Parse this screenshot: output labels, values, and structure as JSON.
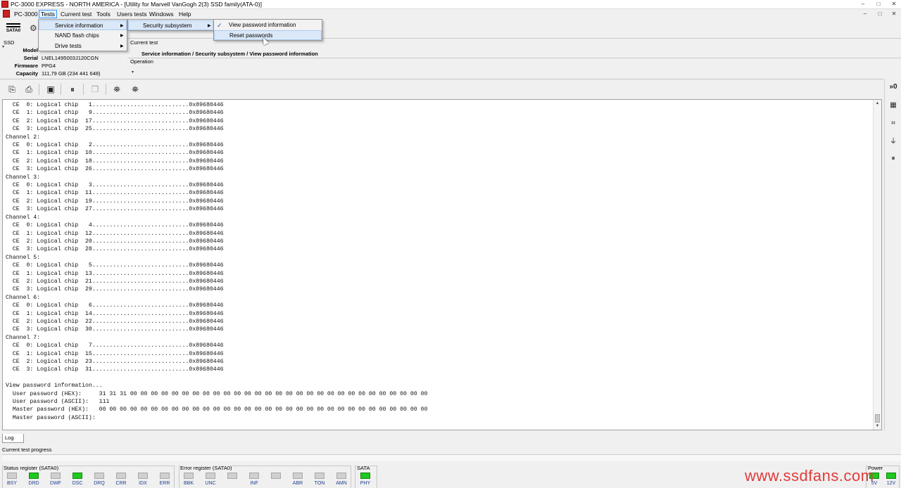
{
  "window": {
    "title": "PC-3000 EXPRESS - NORTH AMERICA - [Utility for Marvell VanGogh 2(3) SSD family(ATA-0)]",
    "controls": [
      "–",
      "□",
      "✕"
    ]
  },
  "menubar": {
    "items": [
      "PC-3000",
      "Tests",
      "Current test",
      "Tools",
      "Users tests",
      "Windows",
      "Help"
    ],
    "mdi_controls": [
      "–",
      "□",
      "✕"
    ]
  },
  "toolbar": {
    "sata_label": "SATA0",
    "icons": [
      "sata-port-icon",
      "gear-icon"
    ]
  },
  "device": {
    "section_label": "SSD",
    "model_label": "Model",
    "serial_label": "Serial",
    "serial": "LNEL1495003J120CGN",
    "firmware_label": "Firmware",
    "firmware": "PPG4",
    "capacity_label": "Capacity",
    "capacity": "111,79 GB (234 441 648)"
  },
  "current_test": {
    "label": "Current test",
    "path": "Service information / Security subsystem / View password information",
    "operation_label": "Operation"
  },
  "menus": {
    "tests": {
      "items": [
        "Service information",
        "NAND flash chips",
        "Drive tests"
      ]
    },
    "service_information": {
      "items": [
        "Security subsystem"
      ]
    },
    "security_subsystem": {
      "items": [
        "View password information",
        "Reset passwords"
      ],
      "checked": "View password information",
      "hovered": "Reset passwords"
    }
  },
  "log": {
    "lines": [
      "  CE  0: Logical chip   1............................0x89680446",
      "  CE  1: Logical chip   9............................0x89680446",
      "  CE  2: Logical chip  17............................0x89680446",
      "  CE  3: Logical chip  25............................0x89680446",
      "Channel 2:",
      "  CE  0: Logical chip   2............................0x89680446",
      "  CE  1: Logical chip  10............................0x89680446",
      "  CE  2: Logical chip  18............................0x89680446",
      "  CE  3: Logical chip  26............................0x89680446",
      "Channel 3:",
      "  CE  0: Logical chip   3............................0x89680446",
      "  CE  1: Logical chip  11............................0x89680446",
      "  CE  2: Logical chip  19............................0x89680446",
      "  CE  3: Logical chip  27............................0x89680446",
      "Channel 4:",
      "  CE  0: Logical chip   4............................0x89680446",
      "  CE  1: Logical chip  12............................0x89680446",
      "  CE  2: Logical chip  20............................0x89680446",
      "  CE  3: Logical chip  28............................0x89680446",
      "Channel 5:",
      "  CE  0: Logical chip   5............................0x89680446",
      "  CE  1: Logical chip  13............................0x89680446",
      "  CE  2: Logical chip  21............................0x89680446",
      "  CE  3: Logical chip  29............................0x89680446",
      "Channel 6:",
      "  CE  0: Logical chip   6............................0x89680446",
      "  CE  1: Logical chip  14............................0x89680446",
      "  CE  2: Logical chip  22............................0x89680446",
      "  CE  3: Logical chip  30............................0x89680446",
      "Channel 7:",
      "  CE  0: Logical chip   7............................0x89680446",
      "  CE  1: Logical chip  15............................0x89680446",
      "  CE  2: Logical chip  23............................0x89680446",
      "  CE  3: Logical chip  31............................0x89680446",
      "",
      "View password information...",
      "  User password (HEX):     31 31 31 00 00 00 00 00 00 00 00 00 00 00 00 00 00 00 00 00 00 00 00 00 00 00 00 00 00 00 00 00",
      "  User password (ASCII):   111",
      "  Master password (HEX):   00 00 00 00 00 00 00 00 00 00 00 00 00 00 00 00 00 00 00 00 00 00 00 00 00 00 00 00 00 00 00 00",
      "  Master password (ASCII):"
    ]
  },
  "bottom": {
    "log_tab": "Log",
    "progress_label": "Current test progress",
    "status_register_title": "Status register (SATA0)",
    "status_leds": [
      {
        "label": "BSY",
        "on": false
      },
      {
        "label": "DRD",
        "on": true
      },
      {
        "label": "DWF",
        "on": false
      },
      {
        "label": "DSC",
        "on": true
      },
      {
        "label": "DRQ",
        "on": false
      },
      {
        "label": "CRR",
        "on": false
      },
      {
        "label": "IDX",
        "on": false
      },
      {
        "label": "ERR",
        "on": false
      }
    ],
    "error_register_title": "Error register (SATA0)",
    "error_leds": [
      {
        "label": "BBK",
        "on": false
      },
      {
        "label": "UNC",
        "on": false
      },
      {
        "label": "",
        "on": false
      },
      {
        "label": "INF",
        "on": false
      },
      {
        "label": "",
        "on": false
      },
      {
        "label": "ABR",
        "on": false
      },
      {
        "label": "TON",
        "on": false
      },
      {
        "label": "AMN",
        "on": false
      }
    ],
    "sata_title": "SATA",
    "sata_leds": [
      {
        "label": "PHY",
        "on": true
      }
    ],
    "power_title": "Power",
    "power_leds": [
      {
        "label": "5V",
        "on": true
      },
      {
        "label": "12V",
        "on": true
      }
    ]
  },
  "watermark": "www.ssdfans.com",
  "colors": {
    "led_on": "#1ec81e",
    "led_off": "#d0d0d0",
    "menu_highlight": "#dbe8f7",
    "watermark": "#e23a3a"
  }
}
